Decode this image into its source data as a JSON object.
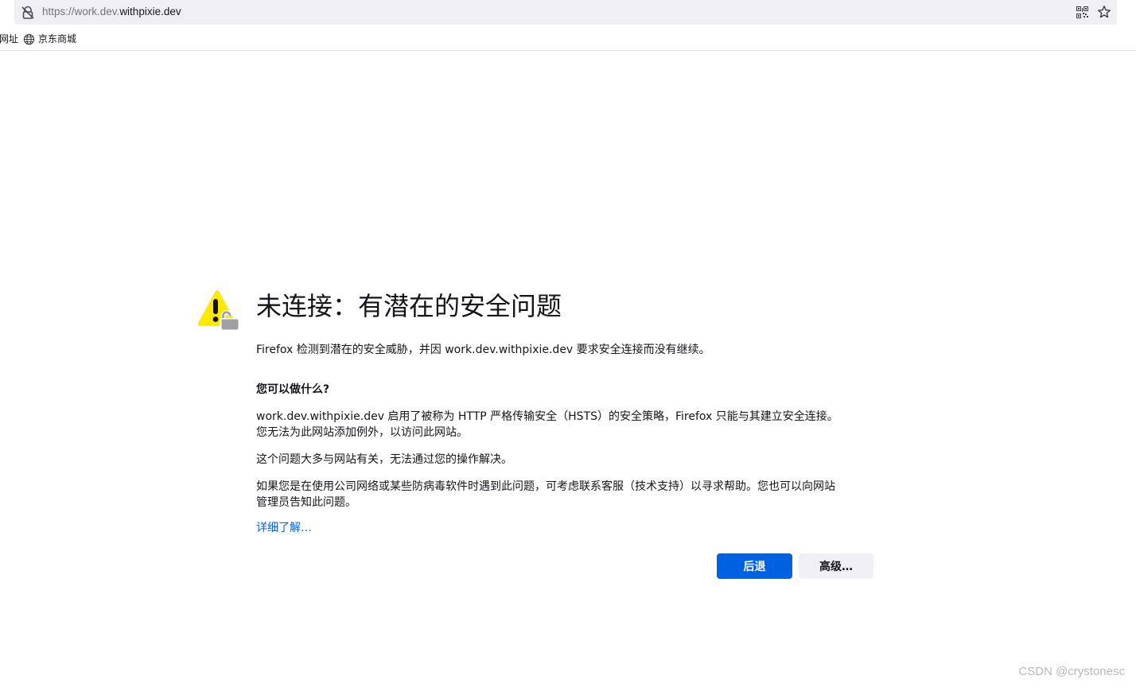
{
  "urlbar": {
    "scheme": "https://",
    "host_prefix": "work.dev.",
    "host_main": "withpixie.dev",
    "lock_icon": "insecure-lock-icon",
    "qr_icon": "qr-code-icon",
    "star_icon": "bookmark-star-icon"
  },
  "bookmarks": {
    "cut_item": "网址",
    "items": [
      {
        "label": "京东商城",
        "icon": "globe-icon"
      }
    ]
  },
  "error": {
    "icon": "warning-lock-icon",
    "title": "未连接：有潜在的安全问题",
    "intro": "Firefox 检测到潜在的安全威胁，并因 work.dev.withpixie.dev 要求安全连接而没有继续。",
    "what_heading": "您可以做什么?",
    "hsts_line1": "work.dev.withpixie.dev 启用了被称为 HTTP 严格传输安全（HSTS）的安全策略，Firefox 只能与其建立安全连接。",
    "hsts_line2": "您无法为此网站添加例外，以访问此网站。",
    "site_issue": "这个问题大多与网站有关，无法通过您的操作解决。",
    "corp_line1": "如果您是在使用公司网络或某些防病毒软件时遇到此问题，可考虑联系客服（技术支持）以寻求帮助。您也可以向网站",
    "corp_line2": "管理员告知此问题。",
    "learn_more": "详细了解…",
    "back_button": "后退",
    "advanced_button": "高级…"
  },
  "watermark": "CSDN @crystonesc",
  "colors": {
    "accent": "#0061e0",
    "warning_yellow": "#ffe900",
    "text": "#15141a"
  }
}
